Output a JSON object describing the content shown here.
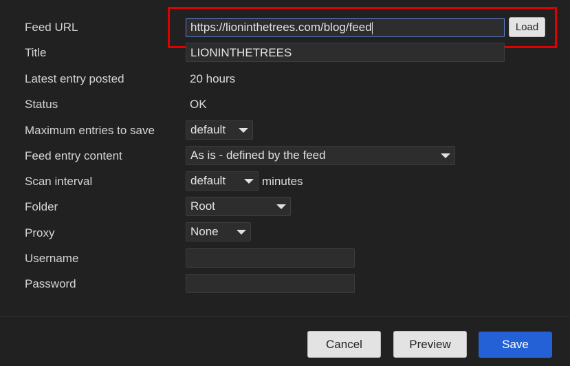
{
  "form": {
    "feed_url": {
      "label": "Feed URL",
      "value": "https://lioninthetrees.com/blog/feed",
      "load_label": "Load"
    },
    "title": {
      "label": "Title",
      "value": "LIONINTHETREES"
    },
    "latest_entry": {
      "label": "Latest entry posted",
      "value": "20 hours"
    },
    "status": {
      "label": "Status",
      "value": "OK"
    },
    "max_entries": {
      "label": "Maximum entries to save",
      "value": "default"
    },
    "entry_content": {
      "label": "Feed entry content",
      "value": "As is - defined by the feed"
    },
    "scan_interval": {
      "label": "Scan interval",
      "value": "default",
      "unit": "minutes"
    },
    "folder": {
      "label": "Folder",
      "value": "Root"
    },
    "proxy": {
      "label": "Proxy",
      "value": "None"
    },
    "username": {
      "label": "Username",
      "value": ""
    },
    "password": {
      "label": "Password",
      "value": ""
    }
  },
  "footer": {
    "cancel": "Cancel",
    "preview": "Preview",
    "save": "Save"
  },
  "colors": {
    "highlight": "#e00000",
    "primary": "#2461d6",
    "focus": "#5b7fd6"
  }
}
